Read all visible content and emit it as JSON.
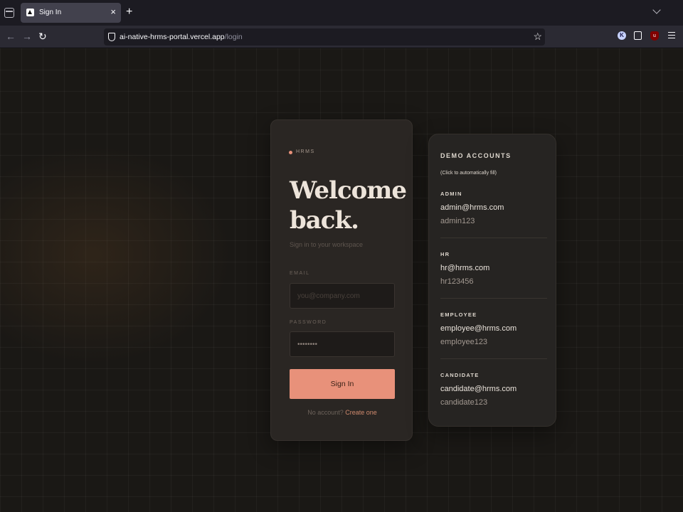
{
  "browser": {
    "tab_title": "Sign In",
    "tab_close": "×",
    "new_tab": "+",
    "url_host": "ai-native-hrms-portal.vercel.app",
    "url_path": "/login",
    "icons": [
      "tab-list-icon",
      "favicon-icon",
      "back-icon",
      "forward-icon",
      "reload-icon",
      "shield-icon",
      "star-icon",
      "extension-k-icon",
      "puzzle-icon",
      "ublock-icon",
      "menu-icon"
    ]
  },
  "login": {
    "brand": "HRMS",
    "heading": "Welcome back.",
    "subtitle": "Sign in to your workspace",
    "email_label": "EMAIL",
    "email_placeholder": "you@company.com",
    "password_label": "PASSWORD",
    "password_value": "••••••••",
    "submit_label": "Sign In",
    "signup_prompt": "No account?",
    "signup_link": "Create one",
    "accent_color": "#e8917a"
  },
  "demo": {
    "title": "DEMO ACCOUNTS",
    "hint": "(Click to automatically fill)",
    "accounts": [
      {
        "role": "ADMIN",
        "email": "admin@hrms.com",
        "password": "admin123"
      },
      {
        "role": "HR",
        "email": "hr@hrms.com",
        "password": "hr123456"
      },
      {
        "role": "EMPLOYEE",
        "email": "employee@hrms.com",
        "password": "employee123"
      },
      {
        "role": "CANDIDATE",
        "email": "candidate@hrms.com",
        "password": "candidate123"
      }
    ]
  }
}
